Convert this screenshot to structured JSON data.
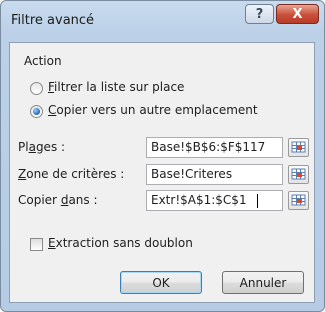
{
  "window": {
    "title": "Filtre avancé",
    "help_label": "?",
    "close_label": "X"
  },
  "action": {
    "label": "Action",
    "options": [
      {
        "access_key": "F",
        "label_rest": "iltrer la liste sur place",
        "selected": false
      },
      {
        "access_key": "C",
        "label_rest": "opier vers un autre emplacement",
        "selected": true
      }
    ]
  },
  "fields": [
    {
      "label_pre": "Pl",
      "access_key": "a",
      "label_post": "ges :",
      "value": "Base!$B$6:$F$117"
    },
    {
      "label_pre": "",
      "access_key": "Z",
      "label_post": "one de critères :",
      "value": "Base!Criteres"
    },
    {
      "label_pre": "Copier ",
      "access_key": "d",
      "label_post": "ans :",
      "value": "Extr!$A$1:$C$1"
    }
  ],
  "unique": {
    "access_key": "E",
    "label_rest": "xtraction sans doublon",
    "checked": false
  },
  "buttons": {
    "ok": "OK",
    "cancel": "Annuler"
  },
  "icons": {
    "help": "help-icon",
    "close": "close-icon",
    "picker": "range-picker-icon"
  }
}
